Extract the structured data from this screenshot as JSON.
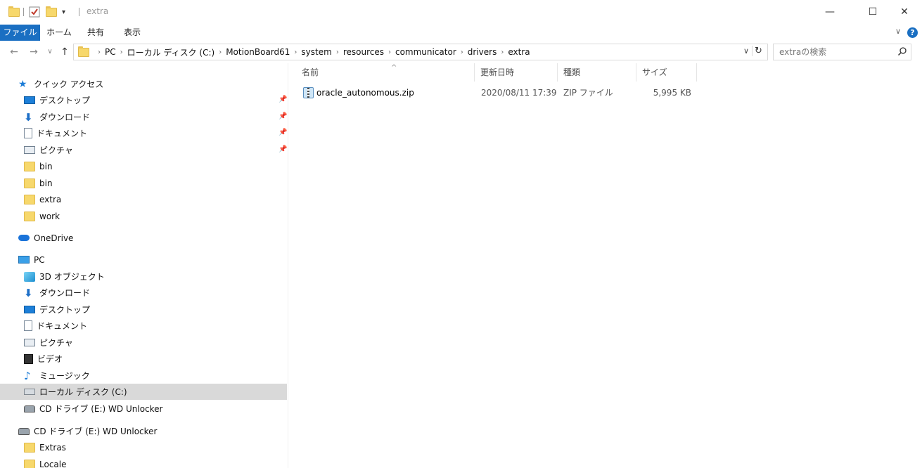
{
  "window": {
    "title": "extra",
    "minimize": "—",
    "maximize": "☐",
    "close": "✕"
  },
  "ribbon": {
    "tabs": [
      "ファイル",
      "ホーム",
      "共有",
      "表示"
    ],
    "expand": "∨",
    "help": "?"
  },
  "nav_buttons": {
    "back": "←",
    "forward": "→",
    "recent": "∨",
    "up": "↑"
  },
  "address": {
    "segments": [
      "PC",
      "ローカル ディスク (C:)",
      "MotionBoard61",
      "system",
      "resources",
      "communicator",
      "drivers",
      "extra"
    ],
    "dropdown": "∨",
    "refresh": "↻"
  },
  "search": {
    "placeholder": "extraの検索"
  },
  "nav_pane": {
    "quick_access": "クイック アクセス",
    "qa_items": [
      {
        "label": "デスクトップ",
        "icon": "desktop-icon",
        "pinned": true
      },
      {
        "label": "ダウンロード",
        "icon": "download-icon",
        "pinned": true
      },
      {
        "label": "ドキュメント",
        "icon": "document-icon",
        "pinned": true
      },
      {
        "label": "ピクチャ",
        "icon": "pictures-icon",
        "pinned": true
      },
      {
        "label": "bin",
        "icon": "folder-icon",
        "pinned": false
      },
      {
        "label": "bin",
        "icon": "folder-icon",
        "pinned": false
      },
      {
        "label": "extra",
        "icon": "folder-icon",
        "pinned": false
      },
      {
        "label": "work",
        "icon": "folder-icon",
        "pinned": false
      }
    ],
    "onedrive": "OneDrive",
    "pc": "PC",
    "pc_items": [
      {
        "label": "3D オブジェクト",
        "icon": "3d-objects-icon"
      },
      {
        "label": "ダウンロード",
        "icon": "download-icon"
      },
      {
        "label": "デスクトップ",
        "icon": "desktop-icon"
      },
      {
        "label": "ドキュメント",
        "icon": "document-icon"
      },
      {
        "label": "ピクチャ",
        "icon": "pictures-icon"
      },
      {
        "label": "ビデオ",
        "icon": "video-icon"
      },
      {
        "label": "ミュージック",
        "icon": "music-icon"
      },
      {
        "label": "ローカル ディスク (C:)",
        "icon": "local-disk-icon",
        "selected": true
      },
      {
        "label": "CD ドライブ (E:) WD Unlocker",
        "icon": "cd-drive-icon"
      }
    ],
    "cd_root": "CD ドライブ (E:) WD Unlocker",
    "cd_items": [
      "Extras",
      "Locale"
    ]
  },
  "columns": {
    "name": "名前",
    "date": "更新日時",
    "type": "種類",
    "size": "サイズ",
    "sort_indicator": "^"
  },
  "files": [
    {
      "name": "oracle_autonomous.zip",
      "date": "2020/08/11 17:39",
      "type": "ZIP ファイル",
      "size": "5,995 KB"
    }
  ],
  "colors": {
    "accent": "#1a6fc2",
    "selected_bg": "#d9d9d9",
    "folder": "#f7d86c"
  }
}
